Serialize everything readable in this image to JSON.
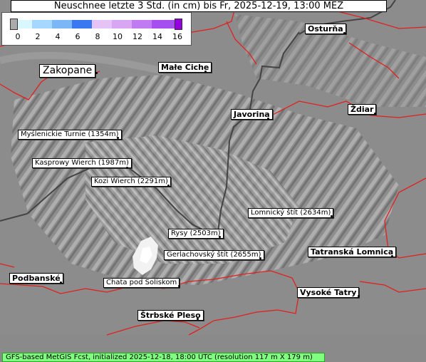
{
  "title": "Neuschnee letzte 3 Std. (in cm) bis Fr, 2025-12-19, 13:00 MEZ",
  "legend": {
    "ticks": [
      "0",
      "2",
      "4",
      "6",
      "8",
      "10",
      "12",
      "14",
      "16"
    ],
    "colors": [
      "#d9d9d9",
      "#cdf6ff",
      "#a6d8ff",
      "#7bb6f6",
      "#2e6ef2",
      "#e0b6f6",
      "#d49bf2",
      "#b25cf0",
      "#9600e0"
    ]
  },
  "places": {
    "zakopane": "Zakopane",
    "male_ciche": "Małe Ciche",
    "osturna": "Osturňa",
    "javorina": "Javorina",
    "zdiar": "Ždiar",
    "mysl": "Myślenickie Turnie (1354m)",
    "kasp": "Kasprowy Wierch (1987m)",
    "kozi": "Kozi Wierch (2291m)",
    "lomnicky": "Lomnický štít (2634m)",
    "rysy": "Rysy (2503m)",
    "gerlach": "Gerlachovský štít (2655m)",
    "tatr_lomnica": "Tatranská Lomnica",
    "podbanske": "Podbanské",
    "chata": "Chata pod Soliskom",
    "vysoke": "Vysoké Tatry",
    "strbske": "Štrbské Pleso"
  },
  "footer": "GFS-based MetGIS Fcst, initialized 2025-12-18, 18:00 UTC  (resolution 117 m X 179 m)"
}
